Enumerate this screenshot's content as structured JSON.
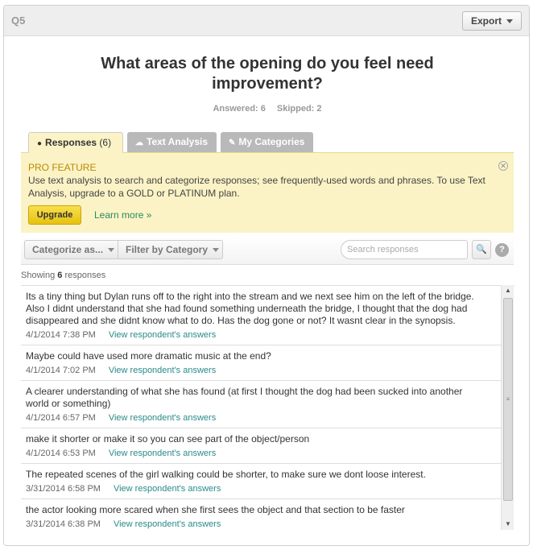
{
  "header": {
    "question_label": "Q5",
    "export_label": "Export"
  },
  "question": {
    "title_line1": "What areas of the opening do you feel need",
    "title_line2": "improvement?",
    "answered": "Answered: 6",
    "skipped": "Skipped: 2"
  },
  "tabs": [
    {
      "label": "Responses",
      "count": "(6)",
      "icon": "speech-bubble-icon"
    },
    {
      "label": "Text Analysis",
      "icon": "cloud-icon"
    },
    {
      "label": "My Categories",
      "icon": "tag-icon"
    }
  ],
  "pro": {
    "title": "PRO FEATURE",
    "text": "Use text analysis to search and categorize responses; see frequently-used words and phrases. To use Text Analysis, upgrade to a GOLD or PLATINUM plan.",
    "upgrade_label": "Upgrade",
    "learn_more": "Learn more »"
  },
  "filters": {
    "categorize_label": "Categorize as...",
    "filter_label": "Filter by Category",
    "search_placeholder": "Search responses"
  },
  "showing": {
    "prefix": "Showing",
    "count": "6",
    "suffix": "responses"
  },
  "responses": [
    {
      "text": "Its a tiny thing but Dylan runs off to the right into the stream and we next see him on the left of the bridge. Also I didnt understand that she had found something underneath the bridge, I thought that the dog had disappeared and she didnt know what to do. Has the dog gone or not? It wasnt clear in the synopsis.",
      "date": "4/1/2014 7:38 PM",
      "link": "View respondent's answers"
    },
    {
      "text": "Maybe could have used more dramatic music at the end?",
      "date": "4/1/2014 7:02 PM",
      "link": "View respondent's answers"
    },
    {
      "text": "A clearer understanding of what she has found (at first I thought the dog had been sucked into another world or something)",
      "date": "4/1/2014 6:57 PM",
      "link": "View respondent's answers"
    },
    {
      "text": "make it shorter or make it so you can see part of the object/person",
      "date": "4/1/2014 6:53 PM",
      "link": "View respondent's answers"
    },
    {
      "text": "The repeated scenes of the girl walking could be shorter, to make sure we dont loose interest.",
      "date": "3/31/2014 6:58 PM",
      "link": "View respondent's answers"
    },
    {
      "text": "the actor looking more scared when she first sees the object and that section to be faster",
      "date": "3/31/2014 6:38 PM",
      "link": "View respondent's answers"
    }
  ]
}
